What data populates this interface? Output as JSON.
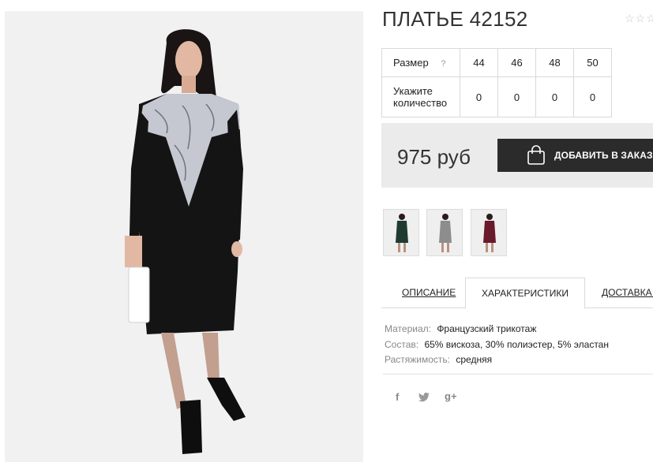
{
  "product": {
    "title": "ПЛАТЬЕ 42152",
    "rating_icons": [
      "star-icon",
      "star-icon",
      "star-icon"
    ]
  },
  "size_table": {
    "size_label": "Размер",
    "help_mark": "?",
    "sizes": [
      "44",
      "46",
      "48",
      "50"
    ],
    "qty_label_line1": "Укажите",
    "qty_label_line2": "количество",
    "quantities": [
      "0",
      "0",
      "0",
      "0"
    ]
  },
  "buy": {
    "price": "975 руб",
    "add_button_label": "ДОБАВИТЬ В ЗАКАЗ",
    "button_icon": "shopping-bag-icon"
  },
  "color_variants": [
    {
      "name": "dark-green",
      "color": "#1f3b30"
    },
    {
      "name": "grey",
      "color": "#8d8d8d"
    },
    {
      "name": "burgundy",
      "color": "#6a1a2a"
    }
  ],
  "tabs": [
    {
      "label": "ОПИСАНИЕ",
      "active": false
    },
    {
      "label": "ХАРАКТЕРИСТИКИ",
      "active": true
    },
    {
      "label": "ДОСТАВКА И",
      "active": false
    }
  ],
  "specs": [
    {
      "label": "Материал:",
      "value": "Французский трикотаж"
    },
    {
      "label": "Состав:",
      "value": "65% вискоза, 30% полиэстер, 5% эластан"
    },
    {
      "label": "Растяжимость:",
      "value": "средняя"
    }
  ],
  "social": {
    "facebook": "f",
    "twitter": "twitter-icon",
    "google_plus": "g+"
  },
  "colors": {
    "button_bg": "#2b2b2b",
    "buy_box_bg": "#ebebeb",
    "border": "#d9d9d9"
  }
}
